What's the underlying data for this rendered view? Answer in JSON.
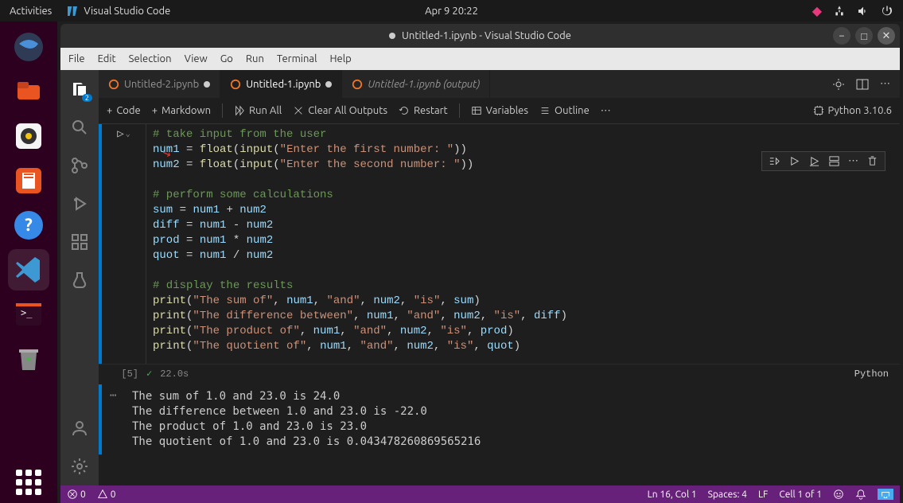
{
  "topbar": {
    "activities": "Activities",
    "app": "Visual Studio Code",
    "clock": "Apr 9  20:22"
  },
  "titlebar": {
    "title": "Untitled-1.ipynb - Visual Studio Code"
  },
  "menu": [
    "File",
    "Edit",
    "Selection",
    "View",
    "Go",
    "Run",
    "Terminal",
    "Help"
  ],
  "activitybar": {
    "explorer_badge": "2"
  },
  "tabs": [
    {
      "label": "Untitled-2.ipynb",
      "active": false,
      "dirty": true,
      "italic": false
    },
    {
      "label": "Untitled-1.ipynb",
      "active": true,
      "dirty": true,
      "italic": false
    },
    {
      "label": "Untitled-1.ipynb (output)",
      "active": false,
      "dirty": false,
      "italic": true
    }
  ],
  "nb": {
    "code": "Code",
    "markdown": "Markdown",
    "runall": "Run All",
    "clear": "Clear All Outputs",
    "restart": "Restart",
    "variables": "Variables",
    "outline": "Outline",
    "kernel": "Python 3.10.6"
  },
  "cell": {
    "exec_count": "[5]",
    "time": "22.0s",
    "lang": "Python",
    "lines": [
      {
        "t": "cmt",
        "s": "# take input from the user"
      },
      {
        "t": "assign",
        "v": "num1",
        "rhs": [
          [
            "fn",
            "float"
          ],
          [
            "p",
            "("
          ],
          [
            "fn",
            "input"
          ],
          [
            "p",
            "("
          ],
          [
            "str",
            "\"Enter the first number: \""
          ],
          [
            "p",
            ")"
          ],
          [
            "p",
            ")"
          ]
        ]
      },
      {
        "t": "assign",
        "v": "num2",
        "rhs": [
          [
            "fn",
            "float"
          ],
          [
            "p",
            "("
          ],
          [
            "fn",
            "input"
          ],
          [
            "p",
            "("
          ],
          [
            "str",
            "\"Enter the second number: \""
          ],
          [
            "p",
            ")"
          ],
          [
            "p",
            ")"
          ]
        ]
      },
      {
        "t": "blank"
      },
      {
        "t": "cmt",
        "s": "# perform some calculations"
      },
      {
        "t": "assign",
        "v": "sum",
        "rhs": [
          [
            "var",
            "num1"
          ],
          [
            "op",
            " + "
          ],
          [
            "var",
            "num2"
          ]
        ]
      },
      {
        "t": "assign",
        "v": "diff",
        "rhs": [
          [
            "var",
            "num1"
          ],
          [
            "op",
            " - "
          ],
          [
            "var",
            "num2"
          ]
        ]
      },
      {
        "t": "assign",
        "v": "prod",
        "rhs": [
          [
            "var",
            "num1"
          ],
          [
            "op",
            " * "
          ],
          [
            "var",
            "num2"
          ]
        ]
      },
      {
        "t": "assign",
        "v": "quot",
        "rhs": [
          [
            "var",
            "num1"
          ],
          [
            "op",
            " / "
          ],
          [
            "var",
            "num2"
          ]
        ]
      },
      {
        "t": "blank"
      },
      {
        "t": "cmt",
        "s": "# display the results"
      },
      {
        "t": "print",
        "args": [
          [
            "str",
            "\"The sum of\""
          ],
          [
            "p",
            ", "
          ],
          [
            "var",
            "num1"
          ],
          [
            "p",
            ", "
          ],
          [
            "str",
            "\"and\""
          ],
          [
            "p",
            ", "
          ],
          [
            "var",
            "num2"
          ],
          [
            "p",
            ", "
          ],
          [
            "str",
            "\"is\""
          ],
          [
            "p",
            ", "
          ],
          [
            "var",
            "sum"
          ]
        ]
      },
      {
        "t": "print",
        "args": [
          [
            "str",
            "\"The difference between\""
          ],
          [
            "p",
            ", "
          ],
          [
            "var",
            "num1"
          ],
          [
            "p",
            ", "
          ],
          [
            "str",
            "\"and\""
          ],
          [
            "p",
            ", "
          ],
          [
            "var",
            "num2"
          ],
          [
            "p",
            ", "
          ],
          [
            "str",
            "\"is\""
          ],
          [
            "p",
            ", "
          ],
          [
            "var",
            "diff"
          ]
        ]
      },
      {
        "t": "print",
        "args": [
          [
            "str",
            "\"The product of\""
          ],
          [
            "p",
            ", "
          ],
          [
            "var",
            "num1"
          ],
          [
            "p",
            ", "
          ],
          [
            "str",
            "\"and\""
          ],
          [
            "p",
            ", "
          ],
          [
            "var",
            "num2"
          ],
          [
            "p",
            ", "
          ],
          [
            "str",
            "\"is\""
          ],
          [
            "p",
            ", "
          ],
          [
            "var",
            "prod"
          ]
        ]
      },
      {
        "t": "print",
        "args": [
          [
            "str",
            "\"The quotient of\""
          ],
          [
            "p",
            ", "
          ],
          [
            "var",
            "num1"
          ],
          [
            "p",
            ", "
          ],
          [
            "str",
            "\"and\""
          ],
          [
            "p",
            ", "
          ],
          [
            "var",
            "num2"
          ],
          [
            "p",
            ", "
          ],
          [
            "str",
            "\"is\""
          ],
          [
            "p",
            ", "
          ],
          [
            "var",
            "quot"
          ]
        ]
      }
    ]
  },
  "output": [
    "The sum of 1.0 and 23.0 is 24.0",
    "The difference between 1.0 and 23.0 is -22.0",
    "The product of 1.0 and 23.0 is 23.0",
    "The quotient of 1.0 and 23.0 is 0.043478260869565216"
  ],
  "status": {
    "errors": "0",
    "warnings": "0",
    "cursor": "Ln 16, Col 1",
    "spaces": "Spaces: 4",
    "eol": "LF",
    "cell": "Cell 1 of 1"
  }
}
